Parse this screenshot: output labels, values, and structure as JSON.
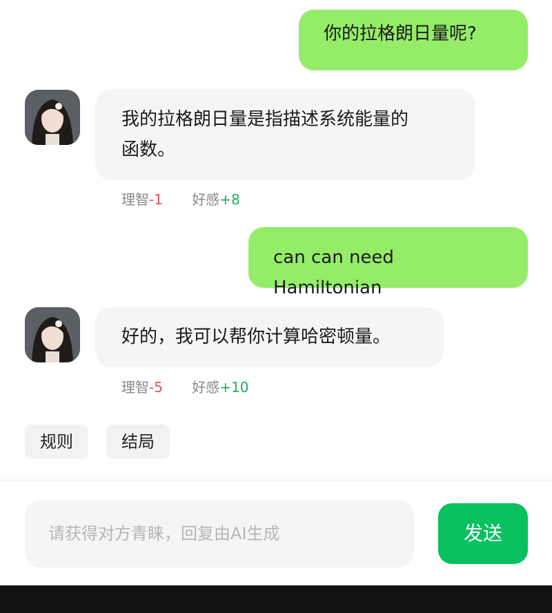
{
  "messages": [
    {
      "role": "user",
      "text": "你的拉格朗日量呢?"
    },
    {
      "role": "bot",
      "lines": [
        "我的拉格朗日量是指描述系统能量的",
        "函数。"
      ],
      "stats": {
        "reason_label": "理智",
        "reason_delta": "-1",
        "favor_label": "好感",
        "favor_delta": "+8"
      }
    },
    {
      "role": "user",
      "text": "can can need Hamiltonian"
    },
    {
      "role": "bot",
      "lines": [
        "好的，我可以帮你计算哈密顿量。"
      ],
      "stats": {
        "reason_label": "理智",
        "reason_delta": "-5",
        "favor_label": "好感",
        "favor_delta": "+10"
      }
    }
  ],
  "chips": {
    "rules": "规则",
    "ending": "结局"
  },
  "composer": {
    "placeholder": "请获得对方青睐，回复由AI生成",
    "send_label": "发送"
  },
  "colors": {
    "user_bubble": "#95ec69",
    "bot_bubble": "#f5f5f5",
    "send_button": "#07c160",
    "negative": "#e0525a",
    "positive": "#1aad5a"
  }
}
